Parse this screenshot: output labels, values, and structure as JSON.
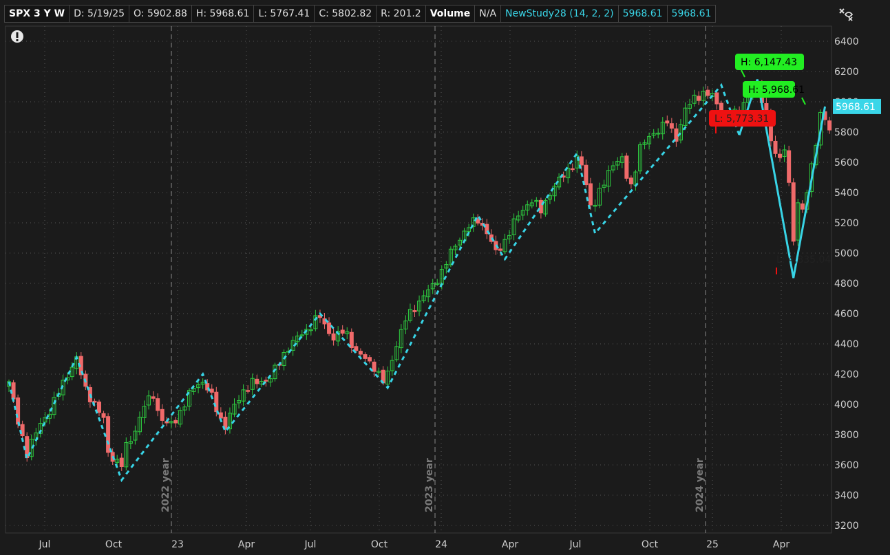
{
  "header": {
    "symbol": "SPX 3 Y W",
    "date": "D: 5/19/25",
    "open": "O: 5902.88",
    "high": "H: 5968.61",
    "low": "L: 5767.41",
    "close": "C: 5802.82",
    "range": "R: 201.2",
    "volume_label": "Volume",
    "volume_value": "N/A",
    "study_label": "NewStudy28 (14, 2, 2)",
    "study_value_1": "5968.61",
    "study_value_2": "5968.61"
  },
  "icons": {
    "menu": "settings-pin-icon",
    "alert": "exclamation-icon"
  },
  "colors": {
    "background": "#1b1b1b",
    "up_candle": "#2ecc40",
    "down_candle": "#f06a6a",
    "zigzag": "#38d4e6",
    "high_label": "#22ee22",
    "low_label": "#ee1111",
    "last_price_bg": "#3ad6e8"
  },
  "chart_data": {
    "type": "candlestick",
    "symbol": "SPX",
    "ylim": [
      3150,
      6500
    ],
    "y_ticks": [
      3200,
      3400,
      3600,
      3800,
      4000,
      4200,
      4400,
      4600,
      4800,
      5000,
      5200,
      5400,
      5600,
      5800,
      6000,
      6200,
      6400
    ],
    "y_tick_labels": [
      "3200",
      "3400",
      "3600",
      "3800",
      "4000",
      "4200",
      "4400",
      "4600",
      "4800",
      "5000",
      "5200",
      "5400",
      "5600",
      "5800",
      "6000",
      "6200",
      "6400"
    ],
    "x_tick_labels": [
      "Jul",
      "Oct",
      "23",
      "Apr",
      "Jul",
      "Oct",
      "24",
      "Apr",
      "Jul",
      "Oct",
      "25",
      "Apr"
    ],
    "year_separators": [
      "2022 year",
      "2023 year",
      "2024 year"
    ],
    "last_price": "5968.61",
    "anchors": [
      {
        "w": 0,
        "p": 4150
      },
      {
        "w": 2,
        "p": 3880
      },
      {
        "w": 4,
        "p": 3680
      },
      {
        "w": 5,
        "p": 3750
      },
      {
        "w": 7,
        "p": 3870
      },
      {
        "w": 9,
        "p": 3960
      },
      {
        "w": 11,
        "p": 4080
      },
      {
        "w": 13,
        "p": 4200
      },
      {
        "w": 15,
        "p": 4300
      },
      {
        "w": 17,
        "p": 4100
      },
      {
        "w": 19,
        "p": 4000
      },
      {
        "w": 21,
        "p": 3900
      },
      {
        "w": 22,
        "p": 3680
      },
      {
        "w": 24,
        "p": 3620
      },
      {
        "w": 25,
        "p": 3600
      },
      {
        "w": 26,
        "p": 3720
      },
      {
        "w": 28,
        "p": 3830
      },
      {
        "w": 30,
        "p": 3990
      },
      {
        "w": 32,
        "p": 4070
      },
      {
        "w": 33,
        "p": 3950
      },
      {
        "w": 35,
        "p": 3860
      },
      {
        "w": 37,
        "p": 3900
      },
      {
        "w": 39,
        "p": 4000
      },
      {
        "w": 41,
        "p": 4120
      },
      {
        "w": 43,
        "p": 4150
      },
      {
        "w": 45,
        "p": 4050
      },
      {
        "w": 47,
        "p": 3900
      },
      {
        "w": 48,
        "p": 3860
      },
      {
        "w": 50,
        "p": 3990
      },
      {
        "w": 52,
        "p": 4090
      },
      {
        "w": 54,
        "p": 4140
      },
      {
        "w": 56,
        "p": 4150
      },
      {
        "w": 58,
        "p": 4180
      },
      {
        "w": 60,
        "p": 4280
      },
      {
        "w": 62,
        "p": 4380
      },
      {
        "w": 64,
        "p": 4440
      },
      {
        "w": 66,
        "p": 4490
      },
      {
        "w": 68,
        "p": 4560
      },
      {
        "w": 69,
        "p": 4580
      },
      {
        "w": 70,
        "p": 4520
      },
      {
        "w": 72,
        "p": 4440
      },
      {
        "w": 74,
        "p": 4480
      },
      {
        "w": 75,
        "p": 4460
      },
      {
        "w": 77,
        "p": 4350
      },
      {
        "w": 79,
        "p": 4300
      },
      {
        "w": 81,
        "p": 4250
      },
      {
        "w": 83,
        "p": 4150
      },
      {
        "w": 84,
        "p": 4200
      },
      {
        "w": 86,
        "p": 4400
      },
      {
        "w": 88,
        "p": 4560
      },
      {
        "w": 90,
        "p": 4640
      },
      {
        "w": 92,
        "p": 4720
      },
      {
        "w": 94,
        "p": 4780
      },
      {
        "w": 96,
        "p": 4880
      },
      {
        "w": 98,
        "p": 5000
      },
      {
        "w": 100,
        "p": 5100
      },
      {
        "w": 102,
        "p": 5180
      },
      {
        "w": 104,
        "p": 5220
      },
      {
        "w": 106,
        "p": 5140
      },
      {
        "w": 108,
        "p": 5000
      },
      {
        "w": 110,
        "p": 5080
      },
      {
        "w": 112,
        "p": 5200
      },
      {
        "w": 114,
        "p": 5290
      },
      {
        "w": 116,
        "p": 5350
      },
      {
        "w": 118,
        "p": 5280
      },
      {
        "w": 120,
        "p": 5400
      },
      {
        "w": 122,
        "p": 5480
      },
      {
        "w": 124,
        "p": 5550
      },
      {
        "w": 126,
        "p": 5620
      },
      {
        "w": 127,
        "p": 5580
      },
      {
        "w": 128,
        "p": 5450
      },
      {
        "w": 129,
        "p": 5320
      },
      {
        "w": 130,
        "p": 5340
      },
      {
        "w": 132,
        "p": 5460
      },
      {
        "w": 134,
        "p": 5600
      },
      {
        "w": 136,
        "p": 5620
      },
      {
        "w": 137,
        "p": 5500
      },
      {
        "w": 138,
        "p": 5440
      },
      {
        "w": 140,
        "p": 5700
      },
      {
        "w": 142,
        "p": 5760
      },
      {
        "w": 144,
        "p": 5820
      },
      {
        "w": 146,
        "p": 5870
      },
      {
        "w": 147,
        "p": 5800
      },
      {
        "w": 148,
        "p": 5760
      },
      {
        "w": 150,
        "p": 5950
      },
      {
        "w": 152,
        "p": 6020
      },
      {
        "w": 154,
        "p": 6060
      },
      {
        "w": 156,
        "p": 6040
      },
      {
        "w": 158,
        "p": 5920
      },
      {
        "w": 160,
        "p": 5890
      },
      {
        "w": 162,
        "p": 5950
      },
      {
        "w": 164,
        "p": 6050
      },
      {
        "w": 166,
        "p": 6080
      },
      {
        "w": 167,
        "p": 6020
      },
      {
        "w": 168,
        "p": 5900
      },
      {
        "w": 169,
        "p": 5760
      },
      {
        "w": 170,
        "p": 5640
      },
      {
        "w": 171,
        "p": 5620
      },
      {
        "w": 172,
        "p": 5700
      },
      {
        "w": 173,
        "p": 5460
      },
      {
        "w": 174,
        "p": 5100
      },
      {
        "w": 175,
        "p": 5300
      },
      {
        "w": 176,
        "p": 5300
      },
      {
        "w": 177,
        "p": 5400
      },
      {
        "w": 178,
        "p": 5600
      },
      {
        "w": 179,
        "p": 5720
      },
      {
        "w": 180,
        "p": 5900
      },
      {
        "w": 181,
        "p": 5900
      },
      {
        "w": 182,
        "p": 5802
      }
    ],
    "labels": [
      {
        "text": "H: 6,147.43",
        "kind": "high",
        "price": 6147.43
      },
      {
        "text": "H: 5,968.61",
        "kind": "high",
        "price": 5968.61
      },
      {
        "text": "L: 5,773.31",
        "kind": "low",
        "price": 5773.31
      },
      {
        "text": "L: 4,835.04",
        "kind": "low",
        "price": 4835.04
      }
    ]
  }
}
